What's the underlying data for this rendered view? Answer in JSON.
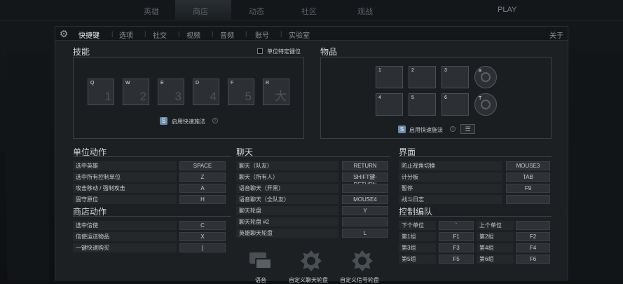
{
  "topbar": {
    "items": [
      "英雄",
      "商店",
      "动态",
      "社区",
      "观战"
    ],
    "status": "PLAY"
  },
  "tabs": [
    {
      "label": "快捷键",
      "active": true
    },
    {
      "label": "选项"
    },
    {
      "label": "社交"
    },
    {
      "label": "视频"
    },
    {
      "label": "音频"
    },
    {
      "label": "账号"
    },
    {
      "label": "实验室"
    }
  ],
  "about": "关于",
  "skills": {
    "title": "技能",
    "unit_specific_label": "单位特定键位",
    "slots": [
      {
        "key": "Q",
        "num": "1"
      },
      {
        "key": "W",
        "num": "2"
      },
      {
        "key": "E",
        "num": "3"
      },
      {
        "key": "D",
        "num": "4"
      },
      {
        "key": "F",
        "num": "5"
      },
      {
        "key": "R",
        "num": "大"
      }
    ],
    "quickcast_label": "启用快速施法"
  },
  "items": {
    "title": "物品",
    "slots": [
      "1",
      "2",
      "3",
      "4",
      "5",
      "6"
    ],
    "round_slots": [
      "8",
      "T"
    ],
    "quickcast_label": "启用快速施法"
  },
  "unit_actions": {
    "title": "单位动作",
    "rows": [
      {
        "label": "选中英雄",
        "key": "SPACE"
      },
      {
        "label": "选中所有控制单位",
        "key": "Z"
      },
      {
        "label": "攻击移动 / 强制攻击",
        "key": "A"
      },
      {
        "label": "固守原位",
        "key": "H"
      }
    ]
  },
  "shop_actions": {
    "title": "商店动作",
    "rows": [
      {
        "label": "选中信使",
        "key": "C"
      },
      {
        "label": "信使运送物品",
        "key": "X"
      },
      {
        "label": "一键快速购买",
        "key": "["
      }
    ]
  },
  "chat": {
    "title": "聊天",
    "rows": [
      {
        "label": "聊天（队友）",
        "key": "RETURN"
      },
      {
        "label": "聊天（所有人）",
        "key": "SHIFT键-RETURN"
      },
      {
        "label": "语音聊天（开黑）",
        "key": ""
      },
      {
        "label": "语音聊天（全队友）",
        "key": "MOUSE4"
      },
      {
        "label": "聊天轮盘",
        "key": "Y"
      },
      {
        "label": "聊天轮盘 #2",
        "key": ""
      },
      {
        "label": "英雄聊天轮盘",
        "key": "L"
      }
    ],
    "wheels": [
      "语音",
      "自定义聊天轮盘",
      "自定义信号轮盘"
    ]
  },
  "interface": {
    "title": "界面",
    "rows": [
      {
        "label": "防止视角切换",
        "key": "MOUSE3"
      },
      {
        "label": "计分板",
        "key": "TAB"
      },
      {
        "label": "暂停",
        "key": "F9"
      },
      {
        "label": "战斗日志",
        "key": ""
      }
    ]
  },
  "control_groups": {
    "title": "控制编队",
    "rows": [
      {
        "l1": "下个单位",
        "k1": "`",
        "l2": "上个单位",
        "k2": ""
      },
      {
        "l1": "第1组",
        "k1": "F1",
        "l2": "第2组",
        "k2": "F2"
      },
      {
        "l1": "第3组",
        "k1": "F3",
        "l2": "第4组",
        "k2": "F4"
      },
      {
        "l1": "第5组",
        "k1": "F5",
        "l2": "第6组",
        "k2": "F6"
      }
    ]
  }
}
